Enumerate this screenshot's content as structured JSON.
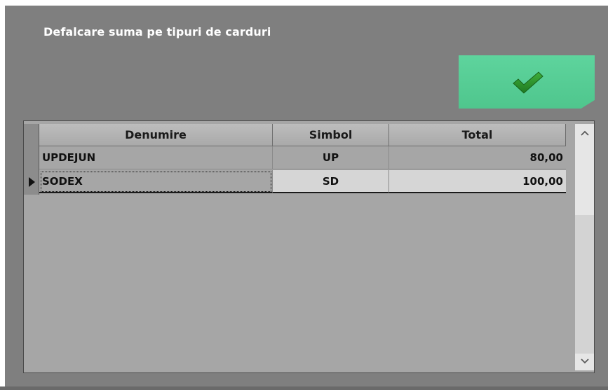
{
  "window": {
    "title": "Defalcare suma pe tipuri de carduri",
    "background_color": "#7f7f7f",
    "ok_button": {
      "icon": "checkmark-icon",
      "color": "#55cc94"
    }
  },
  "grid": {
    "columns": [
      "Denumire",
      "Simbol",
      "Total"
    ],
    "rows": [
      {
        "denumire": "UPDEJUN",
        "simbol": "UP",
        "total": "80,00",
        "selected": false
      },
      {
        "denumire": "SODEX",
        "simbol": "SD",
        "total": "100,00",
        "selected": true
      }
    ],
    "scroll_up_icon": "chevron-up-icon",
    "scroll_down_icon": "chevron-down-icon"
  }
}
